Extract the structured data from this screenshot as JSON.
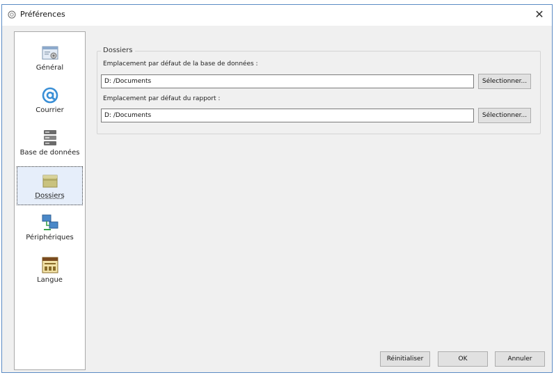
{
  "window": {
    "title": "Préférences",
    "close_glyph": "✕"
  },
  "sidebar": {
    "items": [
      {
        "label": "Général",
        "icon": "general-settings-icon"
      },
      {
        "label": "Courrier",
        "icon": "at-sign-icon"
      },
      {
        "label": "Base de données",
        "icon": "database-icon"
      },
      {
        "label": "Dossiers",
        "icon": "folder-icon",
        "selected": true
      },
      {
        "label": "Périphériques",
        "icon": "devices-icon"
      },
      {
        "label": "Langue",
        "icon": "language-icon"
      }
    ]
  },
  "folders": {
    "group_title": "Dossiers",
    "database_location_label": "Emplacement par défaut de la base de données :",
    "database_location_value": "D: /Documents",
    "report_location_label": "Emplacement par défaut du rapport :",
    "report_location_value": "D: /Documents",
    "select_button_label": "Sélectionner..."
  },
  "footer": {
    "reset_label": "Réinitialiser",
    "ok_label": "OK",
    "cancel_label": "Annuler"
  },
  "colors": {
    "window_border": "#5a8bc4",
    "selected_background": "#e6eefa"
  }
}
